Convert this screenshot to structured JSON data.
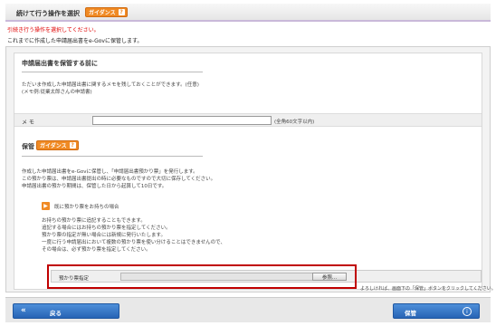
{
  "header": {
    "title": "続けて行う操作を選択",
    "guide_label": "ガイダンス",
    "guide_icon": "question-icon"
  },
  "messages": {
    "error": "引続き行う操作を選択してください。",
    "info": "これまでに作成した申請届出書をe-Govに保管します。"
  },
  "section1": {
    "title": "申請届出書を保管する前に",
    "desc1": "ただいま作成した申請届出書に関するメモを残しておくことができます。(任意)",
    "desc2": "(メモ例:従業太郎さんの申請書)",
    "memo_label": "メ モ",
    "memo_value": "",
    "memo_hint": "(全角60文字以内)"
  },
  "section2": {
    "title": "保管",
    "guide_label": "ガイダンス",
    "line1": "作成した申請届出書をe-Govに保管し、「申請届出書預かり票」を発行します。",
    "line2": "この預かり票は、申請届出書提出の時に必要なものですので大切に保存してください。",
    "line3": "申請届出書の預かり期間は、保管した日から起算して10日です。",
    "sub_title": "既に預かり票をお持ちの場合",
    "sub1": "お持ちの預かり票に追記することもできます。",
    "sub2": "追記する場合にはお持ちの預かり票を指定してください。",
    "sub3": "預かり票の指定が無い場合には新規に発行いたします。",
    "sub4": "一度に行う申請届出において複数の預かり票を使い分けることはできませんので、",
    "sub5": "その場合は、必ず預かり票を指定してください。",
    "field_label": "預かり票指定",
    "field_value": "",
    "browse_label": "参照...",
    "bottom_note": "よろしければ、画面下の「保管」ボタンをクリックしてください。"
  },
  "footer": {
    "back_label": "戻る",
    "save_label": "保管"
  },
  "colors": {
    "accent_orange": "#f08a24",
    "button_blue": "#2764b5",
    "error_red": "#e00000",
    "highlight_red": "#c00000"
  }
}
